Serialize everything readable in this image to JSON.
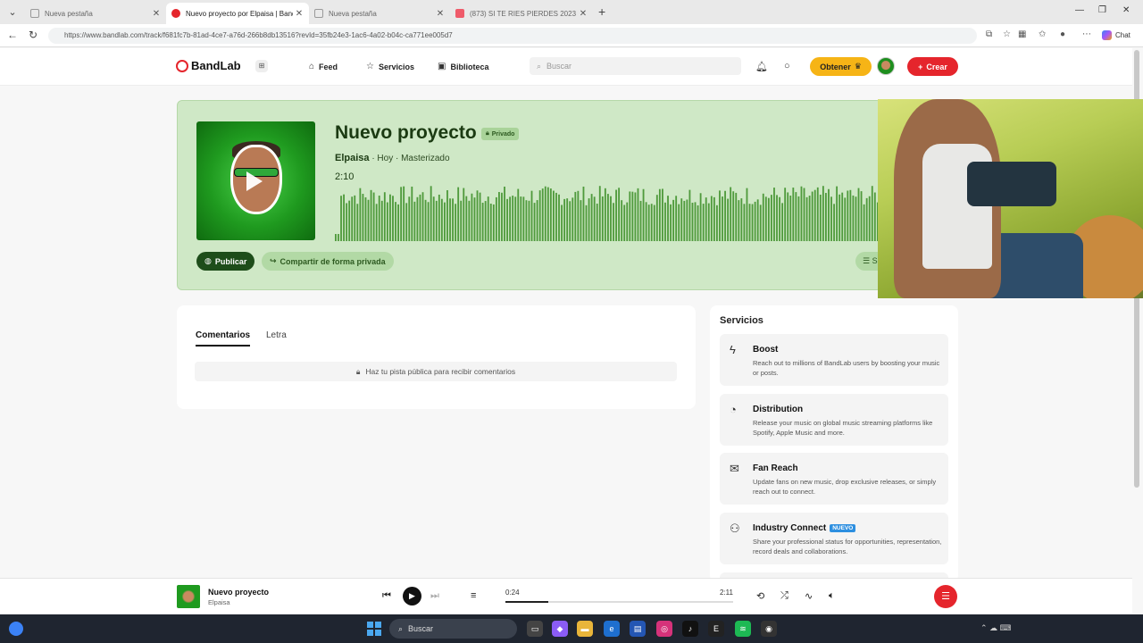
{
  "browser": {
    "tabs": [
      {
        "title": "Nueva pestaña",
        "active": false
      },
      {
        "title": "Nuevo proyecto por Elpaisa | Band",
        "active": true
      },
      {
        "title": "Nueva pestaña",
        "active": false
      },
      {
        "title": "(873) SI TE RIES PIERDES 2023 - (S",
        "active": false
      }
    ],
    "url": "https://www.bandlab.com/track/f681fc7b-81ad-4ce7-a76d-266b8db13516?revId=35fb24e3-1ac6-4a02-b04c-ca771ee005d7",
    "chat_label": "Chat"
  },
  "header": {
    "logo": "BandLab",
    "nav": [
      {
        "label": "Feed",
        "icon": "home-icon"
      },
      {
        "label": "Servicios",
        "icon": "star-icon"
      },
      {
        "label": "Biblioteca",
        "icon": "library-icon"
      }
    ],
    "search_placeholder": "Buscar",
    "obtener_label": "Obtener",
    "crear_label": "Crear"
  },
  "track": {
    "title": "Nuevo proyecto",
    "privacy": "Privado",
    "artist": "Elpaisa",
    "meta": "· Hoy · Masterizado",
    "duration": "2:10",
    "publicar_label": "Publicar",
    "compartir_label": "Compartir de forma privada",
    "more_label": "S"
  },
  "comments": {
    "tabs": [
      "Comentarios",
      "Letra"
    ],
    "note": "Haz tu pista pública para recibir comentarios"
  },
  "services": {
    "title": "Servicios",
    "items": [
      {
        "name": "Boost",
        "icon": "lightning-icon",
        "badge": "",
        "desc": "Reach out to millions of BandLab users by boosting your music or posts."
      },
      {
        "name": "Distribution",
        "icon": "distribution-icon",
        "badge": "",
        "desc": "Release your music on global music streaming platforms like Spotify, Apple Music and more."
      },
      {
        "name": "Fan Reach",
        "icon": "mail-icon",
        "badge": "",
        "desc": "Update fans on new music, drop exclusive releases, or simply reach out to connect."
      },
      {
        "name": "Industry Connect",
        "icon": "people-icon",
        "badge": "NUEVO",
        "desc": "Share your professional status for opportunities, representation, record deals and collaborations."
      }
    ]
  },
  "player": {
    "title": "Nuevo proyecto",
    "artist": "Elpaisa",
    "current_time": "0:24",
    "total_time": "2:11",
    "progress": 0.19
  },
  "taskbar": {
    "search_placeholder": "Buscar"
  },
  "colors": {
    "brand_red": "#e5252c",
    "card_green": "#cfe8c6",
    "waveform_green": "#4f9a3c",
    "obtener_yellow": "#f6b416"
  }
}
